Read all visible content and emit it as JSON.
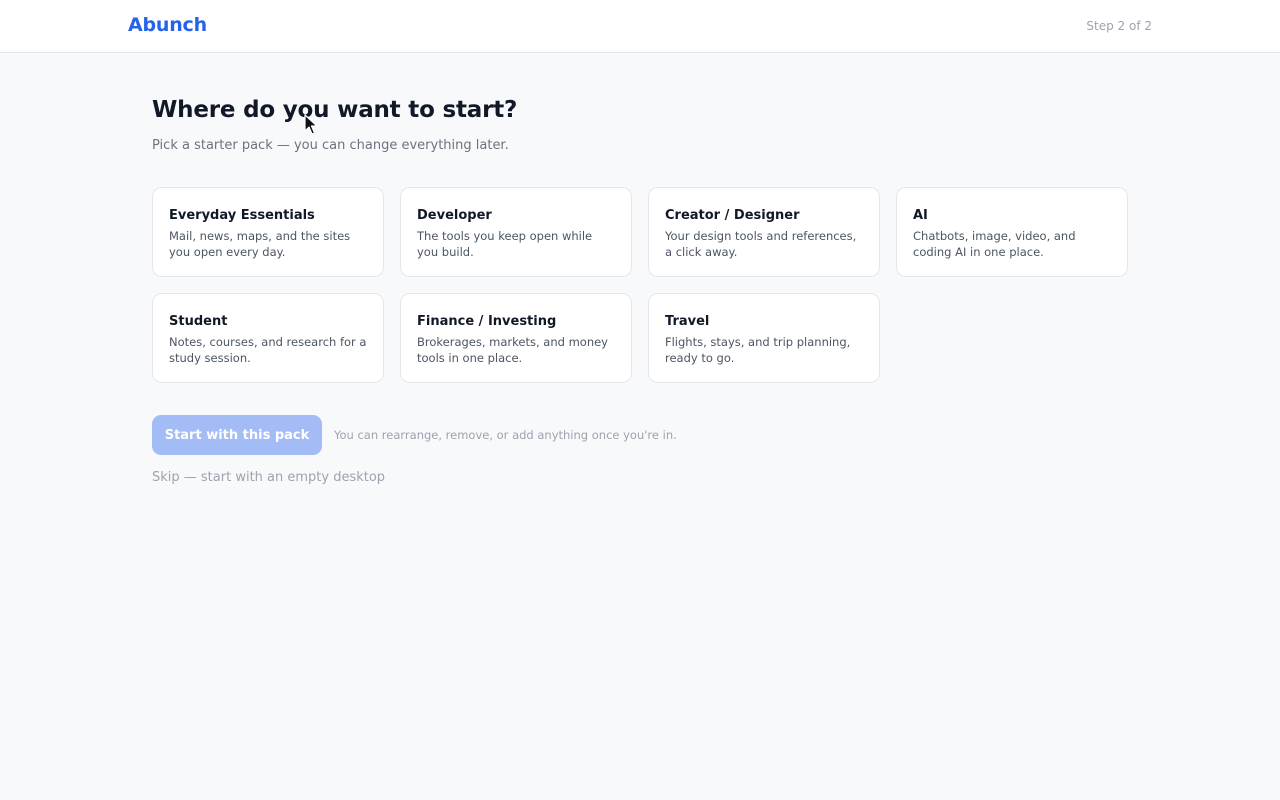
{
  "header": {
    "logo": "Abunch",
    "step": "Step 2 of 2"
  },
  "main": {
    "title": "Where do you want to start?",
    "subtitle": "Pick a starter pack — you can change everything later.",
    "packs": [
      {
        "title": "Everyday Essentials",
        "desc": "Mail, news, maps, and the sites you open every day."
      },
      {
        "title": "Developer",
        "desc": "The tools you keep open while you build."
      },
      {
        "title": "Creator / Designer",
        "desc": "Your design tools and references, a click away."
      },
      {
        "title": "AI",
        "desc": "Chatbots, image, video, and coding AI in one place."
      },
      {
        "title": "Student",
        "desc": "Notes, courses, and research for a study session."
      },
      {
        "title": "Finance / Investing",
        "desc": "Brokerages, markets, and money tools in one place."
      },
      {
        "title": "Travel",
        "desc": "Flights, stays, and trip planning, ready to go."
      }
    ],
    "start_button": "Start with this pack",
    "hint": "You can rearrange, remove, or add anything once you're in.",
    "skip": "Skip — start with an empty desktop"
  },
  "colors": {
    "accent": "#2563eb",
    "button_disabled": "#a4bcf5",
    "background": "#f8f9fb"
  },
  "icons": {
    "cursor": "mouse-pointer-icon"
  }
}
